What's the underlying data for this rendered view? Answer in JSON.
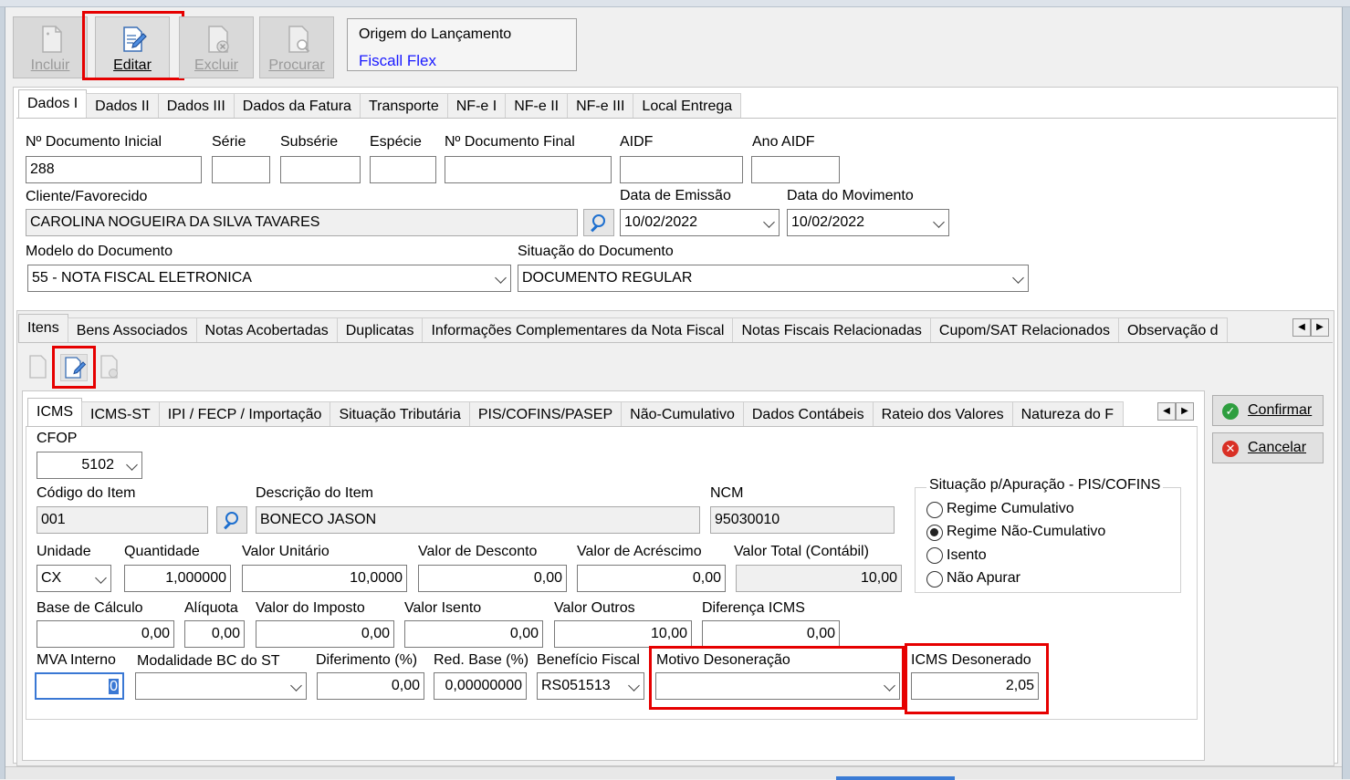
{
  "toolbar": {
    "incluir": "Incluir",
    "editar": "Editar",
    "excluir": "Excluir",
    "procurar": "Procurar"
  },
  "origem": {
    "title": "Origem do Lançamento",
    "value": "Fiscall Flex"
  },
  "top_tabs": [
    "Dados I",
    "Dados II",
    "Dados III",
    "Dados da Fatura",
    "Transporte",
    "NF-e I",
    "NF-e II",
    "NF-e III",
    "Local Entrega"
  ],
  "dados": {
    "doc_inicial_label": "Nº Documento Inicial",
    "doc_inicial": "288",
    "serie_label": "Série",
    "serie": "",
    "subserie_label": "Subsérie",
    "subserie": "",
    "especie_label": "Espécie",
    "especie": "",
    "doc_final_label": "Nº Documento Final",
    "doc_final": "",
    "aidf_label": "AIDF",
    "aidf": "",
    "ano_aidf_label": "Ano AIDF",
    "ano_aidf": "",
    "cliente_label": "Cliente/Favorecido",
    "cliente": "CAROLINA NOGUEIRA DA SILVA TAVARES",
    "emissao_label": "Data de Emissão",
    "emissao": "10/02/2022",
    "movimento_label": "Data do Movimento",
    "movimento": "10/02/2022",
    "modelo_label": "Modelo do Documento",
    "modelo": "55 - NOTA FISCAL ELETRONICA",
    "situacao_label": "Situação do Documento",
    "situacao": "DOCUMENTO REGULAR"
  },
  "mid_tabs": [
    "Itens",
    "Bens Associados",
    "Notas Acobertadas",
    "Duplicatas",
    "Informações Complementares da Nota Fiscal",
    "Notas Fiscais Relacionadas",
    "Cupom/SAT Relacionados",
    "Observação d"
  ],
  "item_tabs": [
    "ICMS",
    "ICMS-ST",
    "IPI / FECP / Importação",
    "Situação Tributária",
    "PIS/COFINS/PASEP",
    "Não-Cumulativo",
    "Dados Contábeis",
    "Rateio dos Valores",
    "Natureza do F"
  ],
  "icms": {
    "cfop_label": "CFOP",
    "cfop": "5102",
    "codigo_label": "Código do Item",
    "codigo": "001",
    "descricao_label": "Descrição do Item",
    "descricao": "BONECO JASON",
    "ncm_label": "NCM",
    "ncm": "95030010",
    "unidade_label": "Unidade",
    "unidade": "CX",
    "quantidade_label": "Quantidade",
    "quantidade": "1,000000",
    "valor_unitario_label": "Valor Unitário",
    "valor_unitario": "10,0000",
    "desconto_label": "Valor de Desconto",
    "desconto": "0,00",
    "acrescimo_label": "Valor de Acréscimo",
    "acrescimo": "0,00",
    "total_label": "Valor Total (Contábil)",
    "total": "10,00",
    "base_label": "Base de Cálculo",
    "base": "0,00",
    "aliquota_label": "Alíquota",
    "aliquota": "0,00",
    "imposto_label": "Valor do Imposto",
    "imposto": "0,00",
    "isento_label": "Valor Isento",
    "isento": "0,00",
    "outros_label": "Valor Outros",
    "outros": "10,00",
    "diferenca_label": "Diferença ICMS",
    "diferenca": "0,00",
    "mva_label": "MVA Interno",
    "mva": "0",
    "modalidade_label": "Modalidade BC do ST",
    "modalidade": "",
    "diferimento_label": "Diferimento (%)",
    "diferimento": "0,00",
    "redbase_label": "Red. Base (%)",
    "redbase": "0,00000000",
    "beneficio_label": "Benefício Fiscal",
    "beneficio": "RS051513",
    "motivo_label": "Motivo Desoneração",
    "motivo": "",
    "desonerado_label": "ICMS Desonerado",
    "desonerado": "2,05"
  },
  "apuracao": {
    "title": "Situação p/Apuração - PIS/COFINS",
    "options": [
      "Regime Cumulativo",
      "Regime Não-Cumulativo",
      "Isento",
      "Não Apurar"
    ],
    "selected": "Regime Não-Cumulativo"
  },
  "actions": {
    "confirmar": "Confirmar",
    "cancelar": "Cancelar"
  },
  "colors": {
    "highlight": "#e60000",
    "link": "#1a1aff",
    "confirm": "#2e9e3f",
    "cancel": "#d93025"
  }
}
